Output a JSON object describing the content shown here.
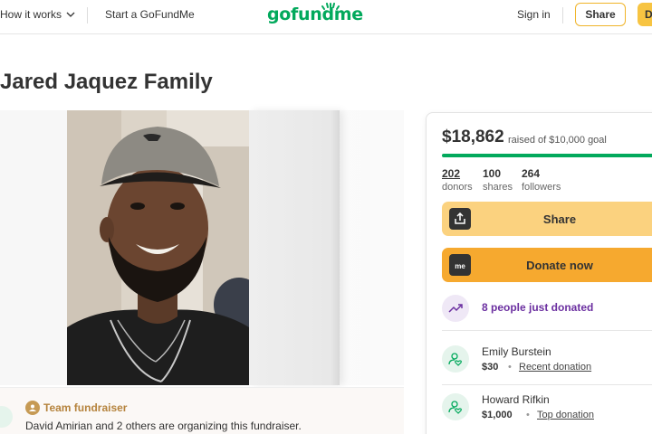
{
  "header": {
    "how_it_works": "How it works",
    "start": "Start a GoFundMe",
    "logo": "gofundme",
    "sign_in": "Sign in",
    "share": "Share",
    "donate": "D"
  },
  "campaign": {
    "title": "Jared Jaquez Family"
  },
  "team": {
    "label": "Team fundraiser",
    "description": "David Amirian and 2 others are organizing this fundraiser."
  },
  "card": {
    "raised": "$18,862",
    "goal_text": "raised of $10,000 goal",
    "progress_percent": 100,
    "stats": [
      {
        "num": "202",
        "label": "donors"
      },
      {
        "num": "100",
        "label": "shares"
      },
      {
        "num": "264",
        "label": "followers"
      }
    ],
    "share_label": "Share",
    "donate_label": "Donate now",
    "donate_icon_text": "me",
    "just_donated": "8 people just donated",
    "donations": [
      {
        "name": "Emily Burstein",
        "amount": "$30",
        "tag": "Recent donation"
      },
      {
        "name": "Howard Rifkin",
        "amount": "$1,000",
        "tag": "Top donation"
      }
    ]
  },
  "colors": {
    "brand_green": "#02a95c",
    "donate_orange": "#f6a92f",
    "share_yellow": "#fbd27f",
    "purple": "#6b2fa0"
  }
}
